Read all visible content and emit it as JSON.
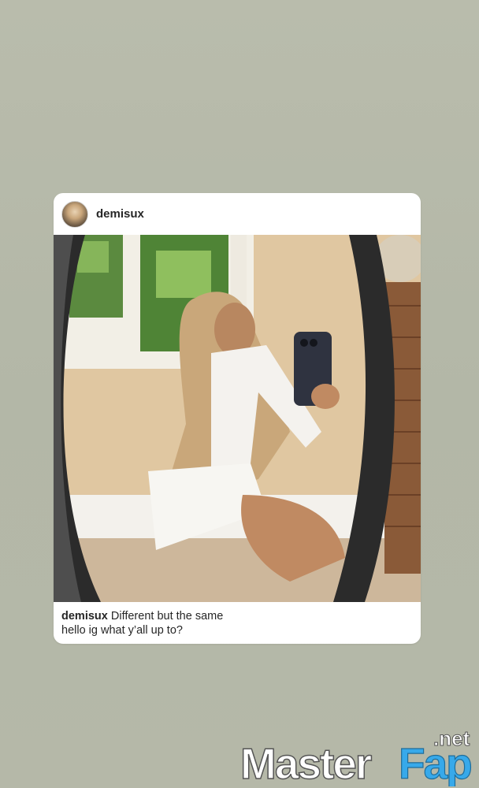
{
  "post": {
    "username": "demisux",
    "caption": {
      "username": "demisux",
      "line1": "Different but the same",
      "line2": "hello ig what y’all up to?"
    }
  },
  "watermark": {
    "text": "MasterFap.net"
  },
  "icons": {
    "avatar": "profile-avatar-photo"
  }
}
